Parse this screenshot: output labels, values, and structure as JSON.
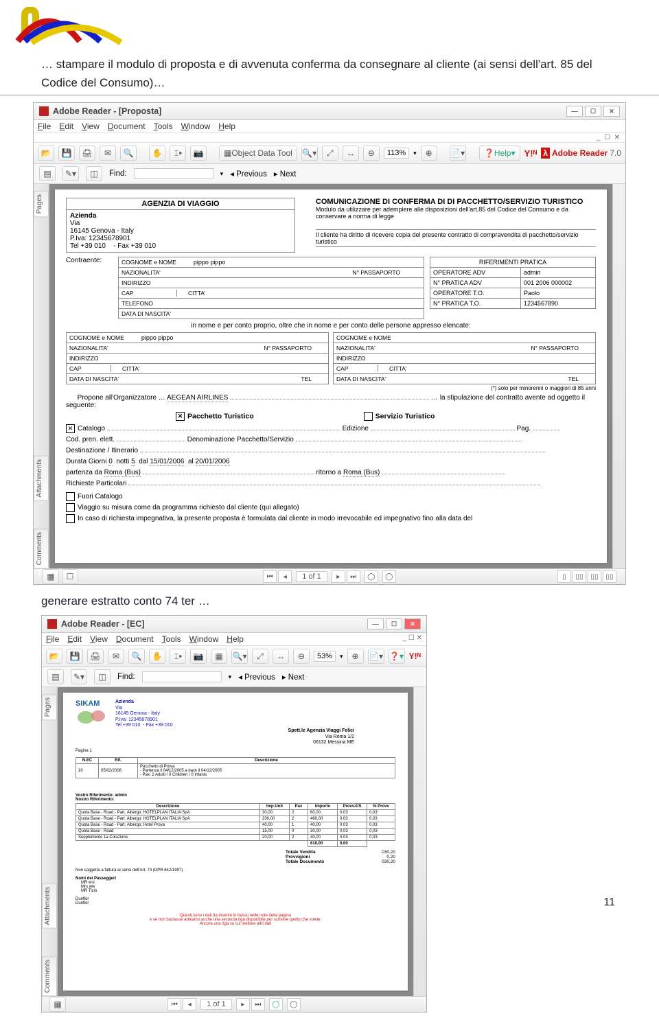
{
  "page_number": "11",
  "intro_text": "… stampare il modulo di proposta e di avvenuta conferma da consegnare al cliente (ai sensi dell'art. 85 del Codice del Consumo)…",
  "caption2": "generare estratto conto 74 ter …",
  "app1": {
    "title": "Adobe Reader - [Proposta]",
    "menus": [
      "File",
      "Edit",
      "View",
      "Document",
      "Tools",
      "Window",
      "Help"
    ],
    "object_data_tool": "Object Data Tool",
    "zoom": "113%",
    "help": "Help",
    "brand": "Adobe Reader",
    "brand_ver": "7.0",
    "find_label": "Find:",
    "find_prev": "Previous",
    "find_next": "Next",
    "sidetabs": [
      "Pages",
      "Attachments",
      "Comments"
    ],
    "pager": "1 of 1"
  },
  "pdf1": {
    "agency_title": "AGENZIA DI VIAGGIO",
    "agency_name": "Azienda",
    "agency_via": "Via",
    "agency_city": "16145 Genova - Italy",
    "agency_piva": "P.Iva: 12345678901",
    "agency_tel": "Tel +39 010",
    "agency_fax": "- Fax +39 010",
    "comm_title": "COMUNICAZIONE DI CONFERMA DI DI PACCHETTO/SERVIZIO TURISTICO",
    "comm_sub": "Modulo da utilizzare per adempiere alle disposizioni dell'art.85 del Codice del Consumo e da conservare a norma di legge",
    "comm_note": "Il cliente ha diritto di ricevere copia del presente contratto di compravendita di pacchetto/servizio turistico",
    "contraente": "Contraente:",
    "r_cognome_lbl": "COGNOME e NOME",
    "r_cognome_val": "pippo pippo",
    "r_naz_lbl": "NAZIONALITA'",
    "r_pass_lbl": "N° PASSAPORTO",
    "r_ind_lbl": "INDIRIZZO",
    "r_cap_lbl": "CAP",
    "r_citta_lbl": "CITTA'",
    "r_tel_lbl": "TELEFONO",
    "r_nascita_lbl": "DATA DI NASCITA'",
    "pratica_title": "RIFERIMENTI PRATICA",
    "pratica_rows": [
      {
        "k": "OPERATORE ADV",
        "v": "admin"
      },
      {
        "k": "N° PRATICA ADV",
        "v": "001 2006 000002"
      },
      {
        "k": "OPERATORE T.O.",
        "v": "Paolo"
      },
      {
        "k": "N° PRATICA T.O.",
        "v": "1234567890"
      }
    ],
    "mid_text": "in nome e per conto proprio, oltre che in nome e per conto delle persone appresso elencate:",
    "p2_cognome": "pippo pippo",
    "minorenni_note": "(*) solo per minorenni o maggiori di 85 anni",
    "propone": "Propone all'Organizzatore …",
    "organizer": "AEGEAN AIRLINES",
    "propone_tail": "… la stipulazione del contratto avente ad oggetto il",
    "seguente": "seguente:",
    "pacchetto": "Pacchetto Turistico",
    "servizio": "Servizio Turistico",
    "catalogo": "Catalogo",
    "edizione": "Edizione",
    "pag": "Pag.",
    "cod_pren": "Cod. pren. elett.",
    "denominazione": "Denominazione  Pacchetto/Servizio",
    "destinazione": "Destinazione / Itinerario",
    "durata": "Durata Giorni",
    "durata_g": "0",
    "notti": "notti",
    "notti_v": "5",
    "dal": "dal",
    "dal_v": "15/01/2006",
    "al": "al",
    "al_v": "20/01/2006",
    "partenza": "partenza da",
    "partenza_v": "Roma (Bus)",
    "ritorno": "ritorno a",
    "ritorno_v": "Roma (Bus)",
    "richieste": "Richieste Particolari",
    "fuori_catalogo": "Fuori Catalogo",
    "viaggio_misura": "Viaggio su misura come da programma richiesto dal cliente (qui allegato)",
    "impegnativa": "In caso di richiesta impegnativa, la presente proposta è formulata dal cliente in modo irrevocabile ed impegnativo fino alla data del",
    "tel_lbl": "TEL"
  },
  "app2": {
    "title": "Adobe Reader - [EC]",
    "menus": [
      "File",
      "Edit",
      "View",
      "Document",
      "Tools",
      "Window",
      "Help"
    ],
    "zoom": "53%",
    "find_label": "Find:",
    "find_prev": "Previous",
    "find_next": "Next",
    "sidetabs": [
      "Pages",
      "Attachments",
      "Comments"
    ],
    "pager": "1 of 1"
  },
  "pdf2": {
    "sikam": "SIKAM",
    "az_name": "Azienda",
    "az_via": "Via",
    "az_city": "16145 Genova - Italy",
    "az_piva": "P.Iva: 12345678901",
    "az_tel": "Tel +39 010",
    "az_fax": "- Fax +39 010",
    "spett": "Spett.le  Agenzia Viaggi Felici",
    "spett_via": "Via Roma 1/2",
    "spett_city": "06132 Messina ME",
    "pagina": "Pagina 1",
    "th": [
      "N.EC",
      "Rif.",
      "Descrizione"
    ],
    "row1_nec": "10",
    "row1_rif": "05/02/2008",
    "row1_desc1": "Pacchetto di Prova",
    "row1_desc2": "- Partenza il 04/12/2005 a back il 04/12/2005",
    "row1_desc3": "- Pax: 2 Adulti / 0 Children / 0 Infants",
    "vref": "Vostro Riferimento: admin",
    "nref": "Nostro Riferimento:",
    "cols": [
      "Descrizione",
      "Imp.Unit",
      "Pax",
      "Importo",
      "Provv.€/S",
      "% Provv"
    ],
    "lines": [
      {
        "d": "Quota Base - Road - Part. Albergo: HOTELPLAN ITALIA SpA",
        "u": "30,00",
        "p": "2",
        "t": "60,00",
        "c": "0,03",
        "pp": "0,03"
      },
      {
        "d": "Quota Base - Road - Part. Albergo: HOTELPLAN ITALIA SpA",
        "u": "230,00",
        "p": "2",
        "t": "460,00",
        "c": "0,03",
        "pp": "0,03"
      },
      {
        "d": "Quota Base - Road - Part. Albergo: Hotel Prova",
        "u": "40,00",
        "p": "1",
        "t": "40,00",
        "c": "0,03",
        "pp": "0,03"
      },
      {
        "d": "Quota Base - Road",
        "u": "15,00",
        "p": "0",
        "t": "30,00",
        "c": "0,03",
        "pp": "0,03"
      },
      {
        "d": "Supplemento 1a Colazione",
        "u": "20,00",
        "p": "2",
        "t": "40,00",
        "c": "0,03",
        "pp": "0,03"
      }
    ],
    "subtotal_imp": "610,00",
    "subtotal_provv": "0,00",
    "tot_vendita_lbl": "Totale Vendita",
    "tot_vendita": "030,20",
    "tot_provv_lbl": "Provvigioni",
    "tot_provv": "0,20",
    "tot_doc_lbl": "Totale Documento",
    "tot_doc": "030,20",
    "non_soggetta": "Non soggetta a fattura ai sensi dell'Art. 74 (DPR 642/1997)",
    "passeggeri_hdr": "Nomi dei Passeggeri",
    "pass1": "MR wsi",
    "pass2": "Mrs ww",
    "pass3": "MR Tizio",
    "gg": "Dunflor",
    "gg2": "Dunflor",
    "footer1": "Questi sono i dati da inserire in basso nelle note della pagina",
    "footer2": "e se non bastasse abbiamo anche una seconda riga disponibile per scrivere quello che volete.",
    "footer3": "Ancora una riga su cui mettere altri dati"
  }
}
